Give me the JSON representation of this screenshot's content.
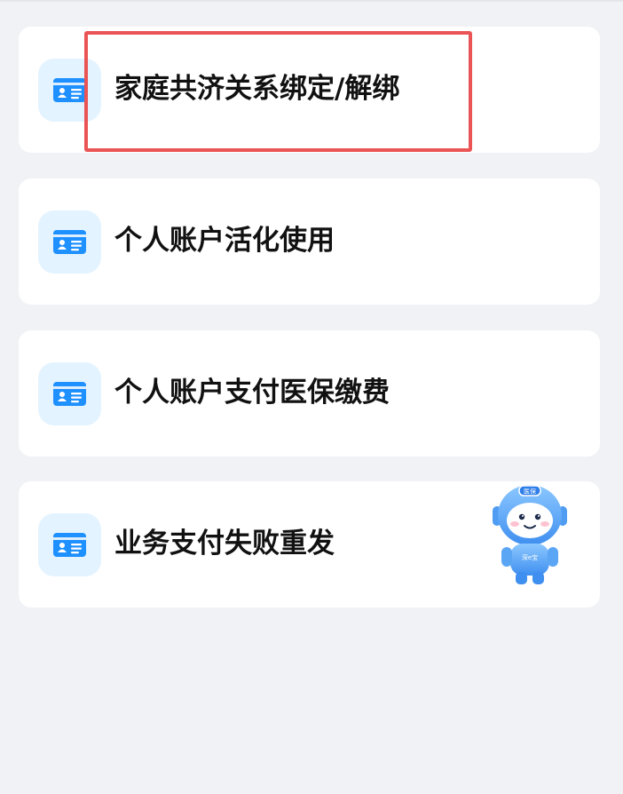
{
  "menu": {
    "items": [
      {
        "label": "家庭共济关系绑定/解绑",
        "icon": "id-card-icon"
      },
      {
        "label": "个人账户活化使用",
        "icon": "id-card-icon"
      },
      {
        "label": "个人账户支付医保缴费",
        "icon": "id-card-icon"
      },
      {
        "label": "业务支付失败重发",
        "icon": "id-card-icon"
      }
    ]
  },
  "mascot": {
    "icon": "robot-mascot-icon",
    "head_badge": "医保",
    "chest_text": "深e宝"
  },
  "colors": {
    "page_background": "#f1f2f6",
    "card_background": "#ffffff",
    "icon_background": "#e3f3ff",
    "icon_blue": "#1e90ff",
    "highlight_red": "#ea5455",
    "text": "#111111"
  }
}
